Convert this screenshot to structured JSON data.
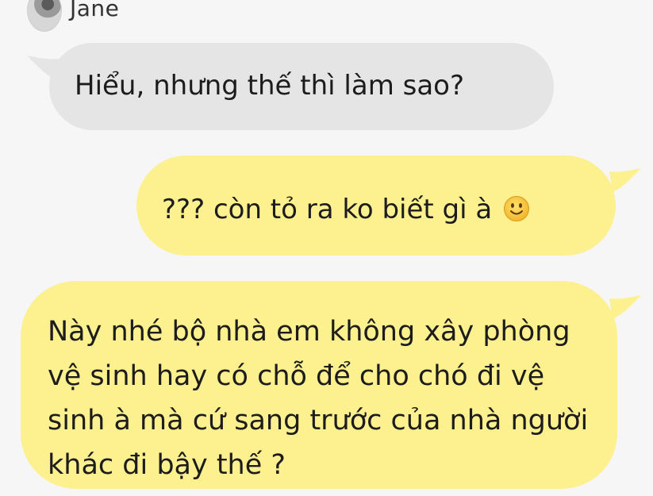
{
  "contact": {
    "name": "Jane"
  },
  "messages": [
    {
      "direction": "incoming",
      "text": "Hiểu, nhưng thế thì làm sao?"
    },
    {
      "direction": "outgoing",
      "text": "??? còn tỏ ra ko biết gì à",
      "emoji": "slightly-smiling-face-icon"
    },
    {
      "direction": "outgoing",
      "text": "Này nhé bộ nhà em không xây phòng vệ sinh hay có chỗ để cho chó đi vệ sinh à mà cứ sang trước của nhà người khác đi bậy thế ?"
    }
  ],
  "colors": {
    "background": "#f6f6f6",
    "incoming_bubble": "#e5e5e5",
    "outgoing_bubble": "#fdf08f",
    "text": "#1c1c1c"
  }
}
